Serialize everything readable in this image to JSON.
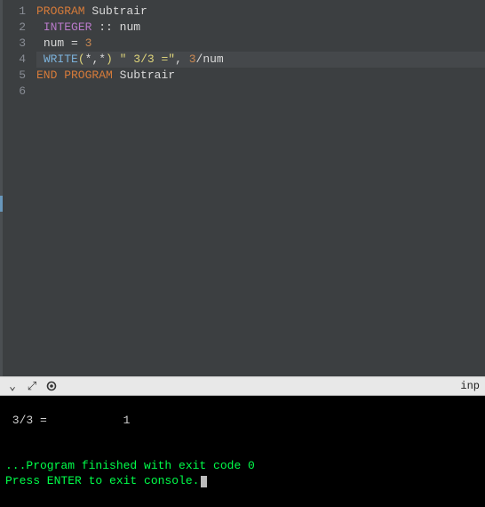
{
  "editor": {
    "line_numbers": [
      "1",
      "2",
      "3",
      "4",
      "5",
      "6"
    ],
    "l1": {
      "kw": "PROGRAM",
      "sp": " ",
      "id": "Subtrair"
    },
    "l2": {
      "ind": " ",
      "typ": "INTEGER",
      "col": " :: ",
      "id": "num"
    },
    "l3": {
      "ind": " ",
      "id": "num",
      "eq": " = ",
      "num": "3"
    },
    "l4": {
      "ind": " ",
      "fn": "WRITE",
      "lp": "(",
      "args": "*,*",
      "rp": ")",
      "sp": " ",
      "str": "\" 3/3 =\"",
      "comma": ", ",
      "n2": "3",
      "slash": "/",
      "var": "num"
    },
    "l5": {
      "kw": "END PROGRAM",
      "sp": " ",
      "id": "Subtrair"
    },
    "l6": ""
  },
  "toolbar": {
    "chevron": "⌄",
    "expand": "⤢",
    "stop": "◉",
    "input_label": "inp"
  },
  "terminal": {
    "out1": " 3/3 =           1",
    "blank": "",
    "msg1": "...Program finished with exit code 0",
    "msg2": "Press ENTER to exit console."
  }
}
